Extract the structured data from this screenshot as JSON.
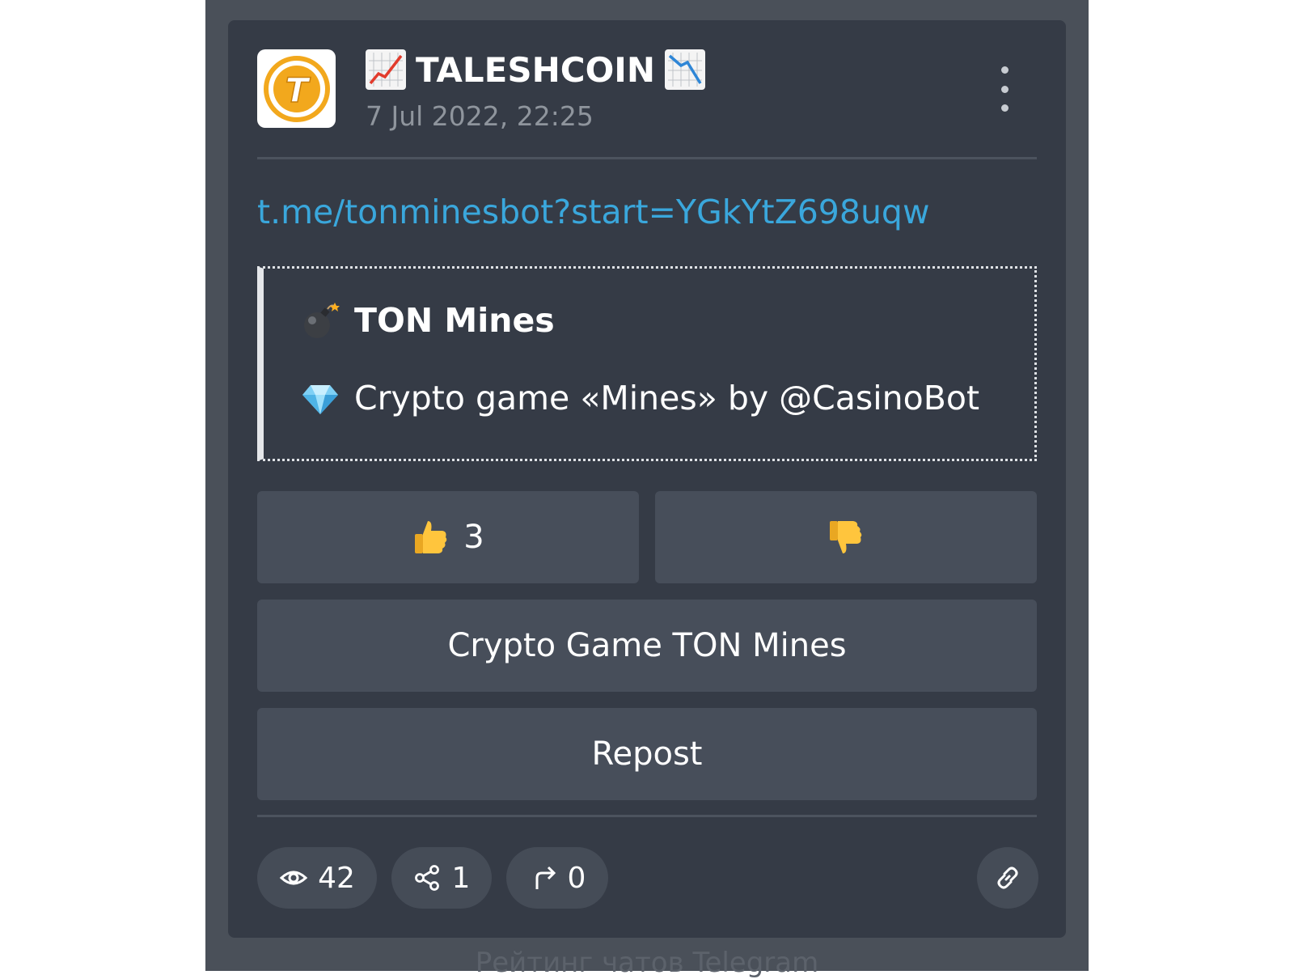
{
  "channel": {
    "title": "TALESHCOIN",
    "date": "7 Jul 2022, 22:25",
    "avatar_letter": "T",
    "title_icons": [
      "chart-increasing-icon",
      "chart-decreasing-icon"
    ]
  },
  "post": {
    "link": "t.me/tonminesbot?start=YGkYtZ698uqw",
    "preview": {
      "title": "TON Mines",
      "title_icon": "bomb-icon",
      "description": "Crypto game «Mines» by @CasinoBot",
      "description_icon": "gem-icon"
    }
  },
  "buttons": {
    "like_count": "3",
    "like_icon": "thumbs-up-icon",
    "dislike_icon": "thumbs-down-icon",
    "game_label": "Crypto Game TON Mines",
    "repost_label": "Repost"
  },
  "stats": {
    "views": "42",
    "shares": "1",
    "forwards": "0"
  },
  "footer": {
    "text": "Рейтинг чатов Telegram"
  },
  "colors": {
    "page_bg": "#4a5059",
    "card_bg": "#353b46",
    "button_bg": "#474e5a",
    "link": "#3aa7dc",
    "avatar_accent": "#f2a81d"
  }
}
